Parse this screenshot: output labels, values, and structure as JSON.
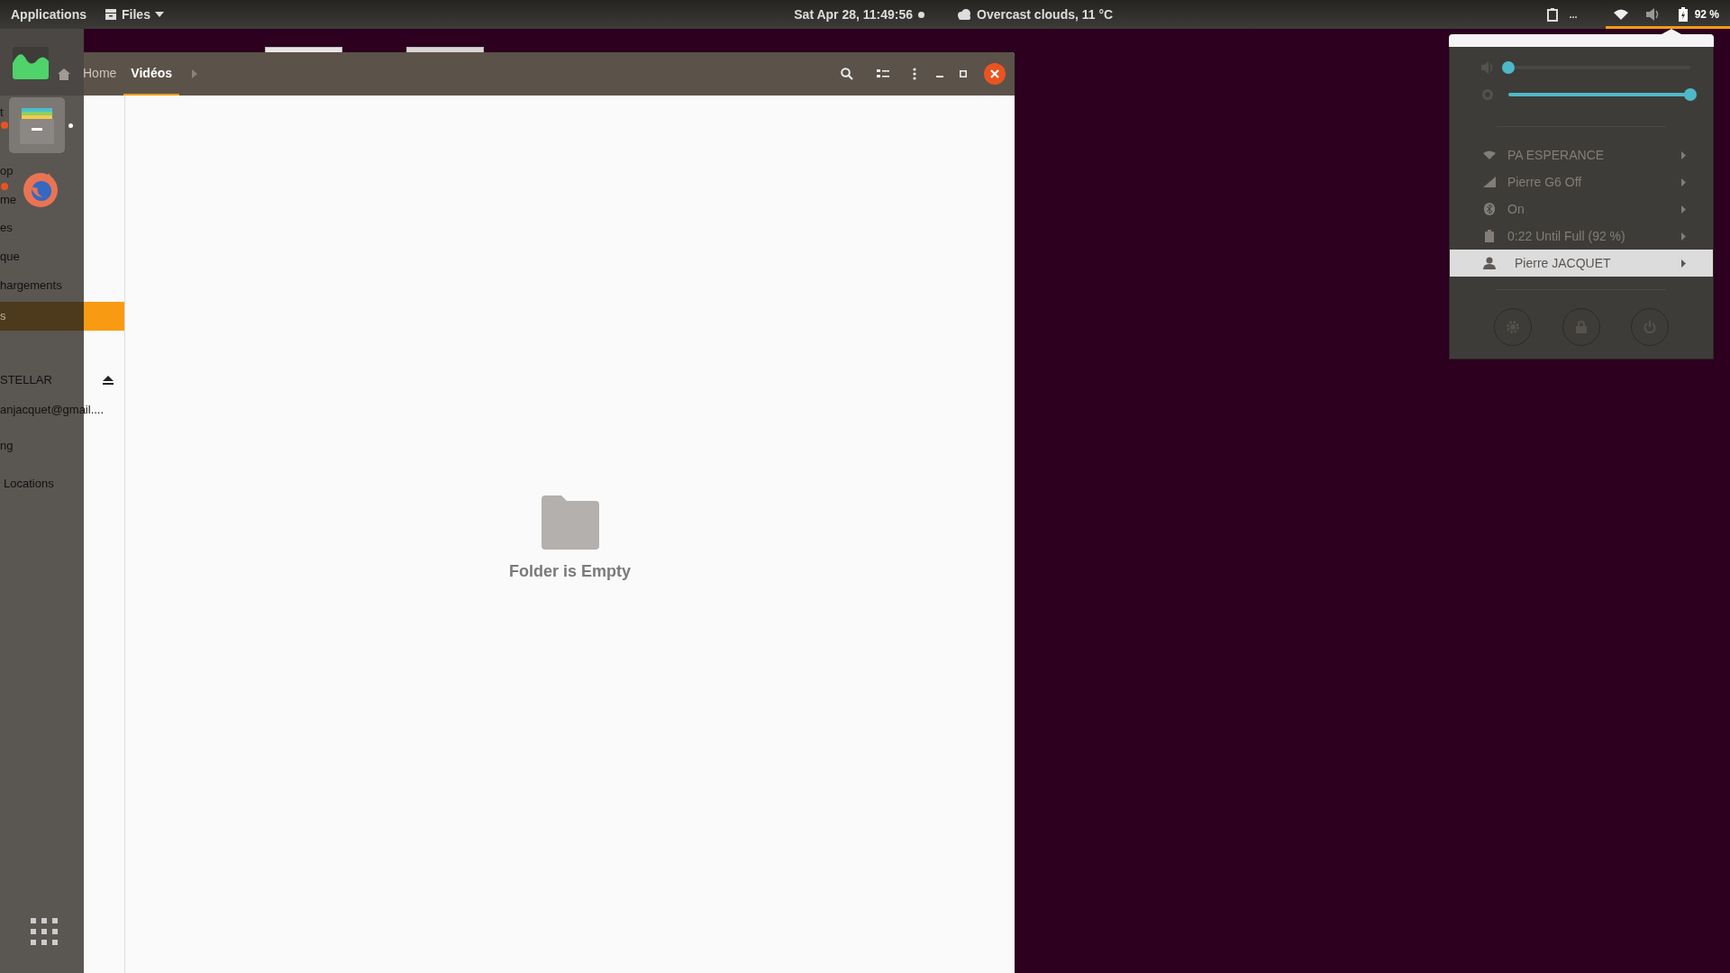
{
  "top_bar": {
    "applications": "Applications",
    "app_menu": "Files",
    "clock": "Sat Apr 28, 11:49:56",
    "weather": "Overcast clouds, 11 °C",
    "clipboard_more": "...",
    "battery": "92 %"
  },
  "dock": {
    "items": [
      {
        "kind": "files",
        "running": true,
        "selected": true
      },
      {
        "kind": "browser",
        "running": true,
        "selected": false
      }
    ]
  },
  "files_window": {
    "path": [
      {
        "label": "Home",
        "selected": false
      },
      {
        "label": "Vidéos",
        "selected": true
      }
    ],
    "sidebar": [
      {
        "label": "t",
        "selected": false,
        "ejectable": false
      },
      {
        "label": "op",
        "selected": false,
        "ejectable": false
      },
      {
        "label": "me",
        "selected": false,
        "ejectable": false
      },
      {
        "label": "es",
        "selected": false,
        "ejectable": false
      },
      {
        "label": "que",
        "selected": false,
        "ejectable": false
      },
      {
        "label": "hargements",
        "selected": false,
        "ejectable": false
      },
      {
        "label": "s",
        "selected": true,
        "ejectable": false
      },
      {
        "label": "STELLAR",
        "selected": false,
        "ejectable": true
      },
      {
        "label": "anjacquet@gmail....",
        "selected": false,
        "ejectable": false
      },
      {
        "label": "ng",
        "selected": false,
        "ejectable": false
      },
      {
        "label": "Locations",
        "selected": false,
        "ejectable": false
      }
    ],
    "empty_message": "Folder is Empty"
  },
  "indicator_menu": {
    "sliders": [
      {
        "kind": "volume",
        "level": 0.0
      },
      {
        "kind": "brightness",
        "level": 1.0
      }
    ],
    "items": [
      {
        "kind": "wifi",
        "label": "PA ESPERANCE",
        "disabled": true,
        "selected": false
      },
      {
        "kind": "cellular",
        "label": "Pierre G6 Off",
        "disabled": true,
        "selected": false
      },
      {
        "kind": "bluetooth",
        "label": "On",
        "disabled": true,
        "selected": false
      },
      {
        "kind": "battery",
        "label": "0:22 Until Full (92 %)",
        "disabled": true,
        "selected": false
      },
      {
        "kind": "user",
        "label": "Pierre JACQUET",
        "disabled": false,
        "selected": true
      }
    ],
    "buttons": [
      {
        "kind": "settings"
      },
      {
        "kind": "lock"
      },
      {
        "kind": "power"
      }
    ]
  }
}
